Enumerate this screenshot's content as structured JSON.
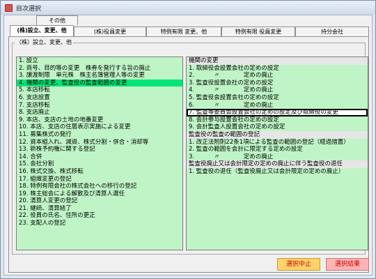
{
  "window": {
    "title": "目次選択"
  },
  "tabs_top": [
    {
      "label": "その他"
    }
  ],
  "tabs_main": [
    {
      "label": "(株)設立、変更、他",
      "active": true
    },
    {
      "label": "(株)役員変更"
    },
    {
      "label": "特例有限 変更、他"
    },
    {
      "label": "特例有限 役員変更"
    },
    {
      "label": "持分会社"
    }
  ],
  "group": {
    "label": "（株）設立、変更、他"
  },
  "left_list": [
    "1. 設立",
    "2. 商号、目的等の変更　株券を発行する旨の廃止",
    "3. 譲渡制限　単元株　株主名簿管理人等の変更",
    "4. 機関の変更、監査役の監査範囲の変更",
    "5. 本店移転",
    "6. 支店設置",
    "7. 支店移転",
    "8. 支店廃止",
    "9. 本店、支店の土地の地番変更",
    "10. 本店、支店の住居表示実施による変更",
    "11. 募集株式の発行",
    "12. 資本組入れ、減資、株式分割・併合・消却等",
    "13. 新株予約権に関する登記",
    "14. 合併",
    "15. 会社分割",
    "16. 株式交換、株式移転",
    "17. 組織変更の登記",
    "18. 特例有限会社の株式会社への移行の登記",
    "19. 株主総会による解散及び清算人選任",
    "20. 清算人変更の登記",
    "21. 継続、清算結了",
    "22. 役員の氏名、住所の更正",
    "23. 支配人の登記"
  ],
  "left_selected_index": 3,
  "right_list": [
    {
      "text": "機関の変更",
      "type": "header"
    },
    {
      "text": "1. 取締役会設置会社の定めの設定",
      "type": "item"
    },
    {
      "text": "2. 　　　〃　　　　定めの廃止",
      "type": "item"
    },
    {
      "text": "3. 監査役設置会社の定めの設定",
      "type": "item"
    },
    {
      "text": "4. 　　　〃　　　　定めの廃止",
      "type": "item"
    },
    {
      "text": "5. 監査役会設置会社の定めの設定",
      "type": "item"
    },
    {
      "text": "6. 　　　〃　　　　定めの廃止",
      "type": "item"
    },
    {
      "text": "7. 監査等委員会設置会社の定めの設定及び取締役の変更",
      "type": "boxed"
    },
    {
      "text": "8. 会計参与設置会社の定めの設定",
      "type": "item"
    },
    {
      "text": "9. 会計監査人設置会社の定めの設定",
      "type": "item"
    },
    {
      "text": "監査役の監査の範囲の登記",
      "type": "header"
    },
    {
      "text": "1. 改正法附則22条1項による監査の範囲の登記（経過措置）",
      "type": "item"
    },
    {
      "text": "2. 監査の範囲を会計に限定する定めの設定",
      "type": "item"
    },
    {
      "text": "3. 　　　〃　　　　定めの廃止",
      "type": "item"
    },
    {
      "text": "監査役廃止又は会計限定の定めの廃止に伴う監査役の退任",
      "type": "header"
    },
    {
      "text": "1. 監査役の退任（監査役廃止又は会計限定の定めの廃止）",
      "type": "item"
    }
  ],
  "buttons": {
    "cancel": "選択中止",
    "result": "選択結果"
  },
  "colors": {
    "list_bg": "#bff5c6",
    "selected": "#00e676",
    "cancel_bg": "#ffd36b",
    "result_bg": "#ffb4b4"
  }
}
